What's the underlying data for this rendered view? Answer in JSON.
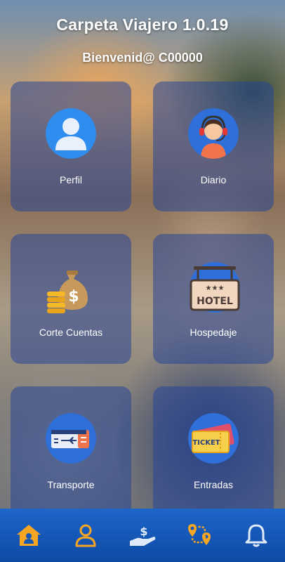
{
  "header": {
    "title": "Carpeta Viajero 1.0.19",
    "welcome": "Bienvenid@ C00000"
  },
  "menu": {
    "items": [
      {
        "label": "Perfil",
        "icon": "user-icon"
      },
      {
        "label": "Diario",
        "icon": "support-agent-icon"
      },
      {
        "label": "Corte Cuentas",
        "icon": "money-bag-coins-icon"
      },
      {
        "label": "Hospedaje",
        "icon": "hotel-sign-icon"
      },
      {
        "label": "Transporte",
        "icon": "plane-ticket-icon"
      },
      {
        "label": "Entradas",
        "icon": "event-ticket-icon"
      }
    ]
  },
  "bottom_nav": {
    "items": [
      {
        "icon": "home-icon",
        "color": "#f6a623"
      },
      {
        "icon": "person-icon",
        "color": "#f6a623"
      },
      {
        "icon": "hand-money-icon",
        "color": "#1e66c9"
      },
      {
        "icon": "route-icon",
        "color": "#f6a623"
      },
      {
        "icon": "bell-icon",
        "color": "#1e66c9"
      }
    ]
  },
  "colors": {
    "accent": "#f6a623",
    "card": "#284696",
    "nav": "#1558b8"
  }
}
